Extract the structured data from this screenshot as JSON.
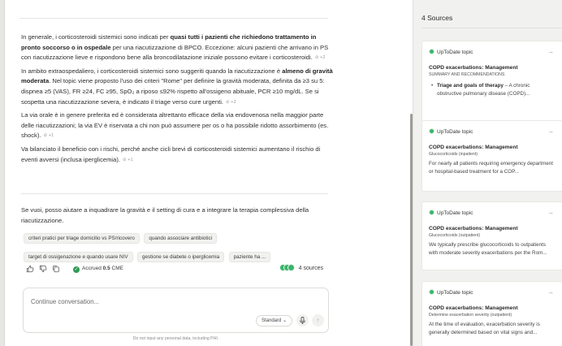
{
  "answer": {
    "p1": {
      "a": "In generale, i corticosteroidi sistemici sono indicati per ",
      "b": "quasi tutti i pazienti che richiedono trattamento in pronto soccorso o in ospedale",
      "c": " per una riacutizzazione di BPCO. Eccezione: alcuni pazienti che arrivano in PS con riacutizzazione lieve e rispondono bene alla broncodilatazione iniziale possono evitare i corticosteroidi.",
      "cite": "+2"
    },
    "p2": {
      "a": "In ambito extraospedaliero, i corticosteroidi sistemici sono suggeriti quando la riacutizzazione è ",
      "b": "almeno di gravità moderata",
      "c": ". Nel topic viene proposto l'uso dei criteri \"Rome\" per definire la gravità moderata, definita da ≥3 su 5: dispnea ≥5 (VAS), FR ≥24, FC ≥95, SpO₂ a riposo ≤92% rispetto all'ossigeno abituale, PCR ≥10 mg/dL. Se si sospetta una riacutizzazione severa, è indicato il triage verso cure urgenti.",
      "cite": "+2"
    },
    "p3": {
      "text": "La via orale è in genere preferita ed è considerata altrettanto efficace della via endovenosa nella maggior parte delle riacutizzazioni; la via EV è riservata a chi non può assumere per os o ha possibile ridotto assorbimento (es. shock).",
      "cite": "+1"
    },
    "p4": {
      "text": "Va bilanciato il beneficio con i rischi, perché anche cicli brevi di corticosteroidi sistemici aumentano il rischio di eventi avversi (inclusa iperglicemia).",
      "cite": "+1"
    }
  },
  "followup": {
    "text": "Se vuoi, posso aiutare a inquadrare la gravità e il setting di cura e a integrare la terapia complessiva della riacutizzazione.",
    "chips": [
      "criteri pratici per triage domicilio vs PS/ricovero",
      "quando associare antibiotici",
      "target di ossigenazione e quando usare NIV",
      "gestione se diabete o iperglicemia",
      "paziente ha ..."
    ]
  },
  "actions": {
    "cme_prefix": "Accrued ",
    "cme_value": "0.5",
    "cme_suffix": " CME",
    "sources_label": "4 sources"
  },
  "composer": {
    "placeholder": "Continue conversation...",
    "mode": "Standard",
    "disclaimer": "Do not input any personal data, including PHI."
  },
  "panel": {
    "title": "4 Sources",
    "cards": [
      {
        "source": "UpToDate topic",
        "title": "COPD exacerbations: Management",
        "subtitle": "SUMMARY AND RECOMMENDATIONS",
        "bullet_bold": "Triage and goals of therapy",
        "bullet_text": " – A chronic obstructive pulmonary disease (COPD)..."
      },
      {
        "source": "UpToDate topic",
        "title": "COPD exacerbations: Management",
        "subtitle": "Glucocorticoids (inpatient)",
        "body": "For nearly all patients requiring emergency department or hospital-based treatment for a COP..."
      },
      {
        "source": "UpToDate topic",
        "title": "COPD exacerbations: Management",
        "subtitle": "Glucocorticoids (outpatient)",
        "body": "We typically prescribe glucocorticoids to outpatients with moderate severity exacerbations per the Rom..."
      },
      {
        "source": "UpToDate topic",
        "title": "COPD exacerbations: Management",
        "subtitle": "Determine exacerbation severity (outpatient)",
        "body": "At the time of evaluation, exacerbation severity is generally determined based on vital signs and..."
      }
    ]
  },
  "colors": {
    "accent_green": "#3bb46a",
    "check_green": "#2e9b52",
    "panel_bg": "#f1f1ef"
  },
  "icons": [
    "thumbs-up-icon",
    "thumbs-down-icon",
    "copy-icon",
    "check-circle-icon",
    "microphone-icon",
    "send-arrow-icon",
    "chevron-down-icon",
    "arrow-right-icon",
    "uptodate-logo-icon"
  ]
}
